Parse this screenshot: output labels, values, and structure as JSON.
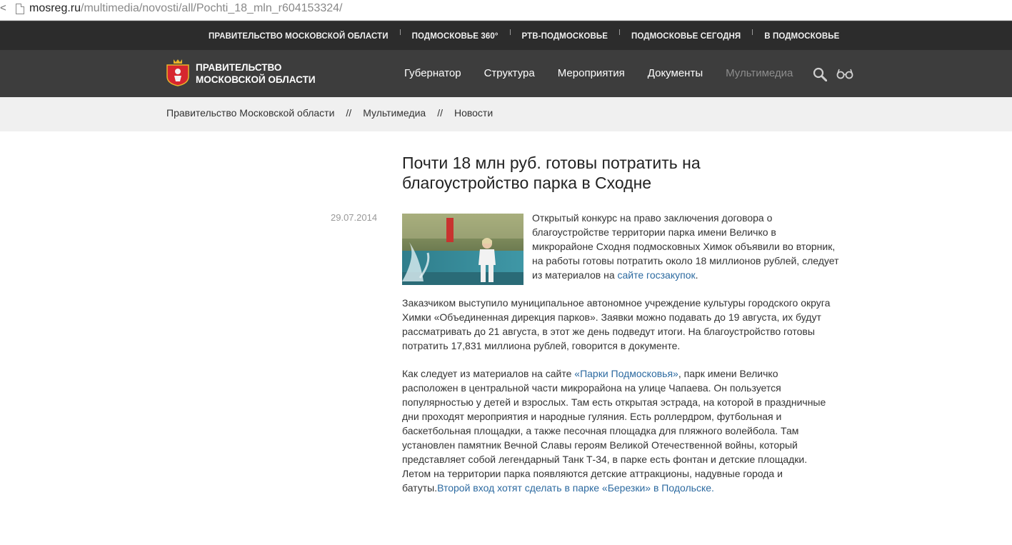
{
  "browser": {
    "url_host": "mosreg.ru",
    "url_path": "/multimedia/novosti/all/Pochti_18_mln_r604153324/"
  },
  "topstrip": {
    "items": [
      "ПРАВИТЕЛЬСТВО МОСКОВСКОЙ ОБЛАСТИ",
      "ПОДМОСКОВЬЕ 360°",
      "РТВ-ПОДМОСКОВЬЕ",
      "ПОДМОСКОВЬЕ СЕГОДНЯ",
      "В ПОДМОСКОВЬЕ"
    ]
  },
  "header": {
    "brand_line1": "ПРАВИТЕЛЬСТВО",
    "brand_line2": "МОСКОВСКОЙ ОБЛАСТИ",
    "nav": [
      "Губернатор",
      "Структура",
      "Мероприятия",
      "Документы",
      "Мультимедиа"
    ],
    "active_nav": "Мультимедиа",
    "icons": [
      "search-icon",
      "glasses-icon"
    ],
    "accent_color": "#d6262f"
  },
  "breadcrumbs": {
    "items": [
      "Правительство Московской области",
      "Мультимедиа",
      "Новости"
    ],
    "separator": "//"
  },
  "article": {
    "title": "Почти 18 млн руб. готовы потратить на благоустройство парка в Сходне",
    "date": "29.07.2014",
    "lead_text": "Открытый конкурс на право заключения договора о благоустройстве территории парка имени Величко в микрорайоне Сходня подмосковных Химок объявили во вторник, на работы готовы потратить около 18 миллионов рублей, следует из материалов на ",
    "lead_link": "сайте госзакупок",
    "lead_end": ".",
    "p1": "Заказчиком выступило муниципальное автономное учреждение культуры городского округа Химки «Объединенная дирекция парков». Заявки можно подавать до 19 августа, их будут рассматривать до 21 августа, в этот же день подведут итоги. На благоустройство готовы потратить 17,831 миллиона рублей, говорится в документе.",
    "p2_start": "Как следует из материалов на сайте ",
    "p2_link": "«Парки Подмосковья»",
    "p2_body": ", парк имени Величко расположен в центральной части микрорайона на улице Чапаева. Он пользуется популярностью у детей и взрослых. Там есть открытая эстрада, на которой в праздничные дни проходят мероприятия и народные гуляния. Есть роллердром, футбольная и баскетбольная площадки, а также песочная площадка для пляжного волейбола. Там установлен памятник Вечной Славы героям Великой Отечественной войны, который представляет собой легендарный Танк Т-34, в парке есть фонтан и детские площадки. Летом на территории парка появляются детские аттракционы, надувные города и батуты.",
    "p2_link2": "Второй вход хотят сделать в парке «Березки» в Подольске."
  }
}
